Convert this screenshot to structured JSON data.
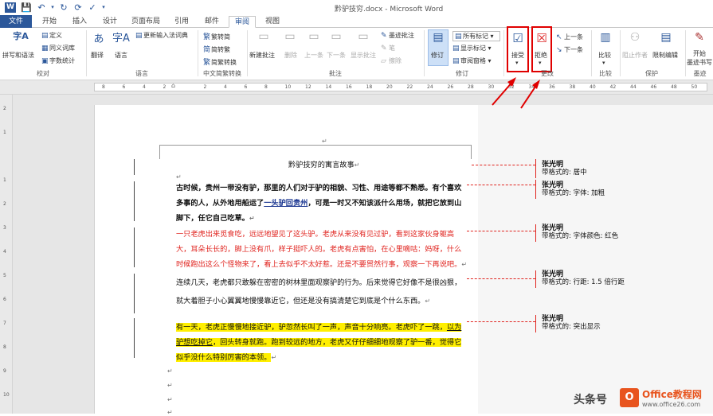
{
  "window": {
    "title": "黔驴技穷.docx - Microsoft Word",
    "quick_access": [
      "W",
      "💾",
      "↶",
      "↻",
      "⟳",
      "✓",
      "▾"
    ]
  },
  "tabs": [
    {
      "label": "文件"
    },
    {
      "label": "开始"
    },
    {
      "label": "插入"
    },
    {
      "label": "设计"
    },
    {
      "label": "页面布局"
    },
    {
      "label": "引用"
    },
    {
      "label": "邮件"
    },
    {
      "label": "审阅"
    },
    {
      "label": "视图"
    }
  ],
  "ribbon": {
    "proofing": {
      "label": "校对",
      "spelling": "拼写和语法",
      "define": "定义",
      "thesaurus": "同义词库",
      "word_count": "字数统计"
    },
    "language": {
      "label": "语言",
      "translate": "翻译",
      "language": "语言",
      "update_ime": "更新输入法词典"
    },
    "chinese": {
      "label": "中文简繁转换",
      "to_simplified": "繁转简",
      "to_traditional": "简转繁",
      "convert": "简繁转换"
    },
    "comments": {
      "label": "批注",
      "new": "新建批注",
      "delete": "删除",
      "previous": "上一条",
      "next": "下一条",
      "show": "显示批注",
      "ink": "墨迹批注",
      "pen": "笔",
      "erase": "擦除"
    },
    "tracking": {
      "label": "修订",
      "track": "修订",
      "all_markup": "所有标记",
      "show_markup": "显示标记",
      "review_pane": "审阅窗格"
    },
    "changes": {
      "label": "更改",
      "accept": "接受",
      "reject": "拒绝",
      "previous": "上一条",
      "next": "下一条"
    },
    "compare": {
      "label": "比较",
      "compare": "比较"
    },
    "protect": {
      "label": "保护",
      "block": "阻止作者",
      "restrict": "限制编辑"
    },
    "onenote": {
      "label": "墨迹",
      "start": "开始",
      "hide": "墨迹书写"
    }
  },
  "ruler": {
    "h_ticks": [
      "8",
      "6",
      "4",
      "2",
      "",
      "2",
      "4",
      "6",
      "8",
      "10",
      "12",
      "14",
      "16",
      "18",
      "20",
      "22",
      "24",
      "26",
      "28",
      "30",
      "32",
      "34",
      "36",
      "38",
      "40",
      "42",
      "44",
      "46",
      "48",
      "50"
    ],
    "v_ticks": [
      "2",
      "1",
      "",
      "1",
      "2",
      "3",
      "4",
      "5",
      "6",
      "7",
      "8",
      "9",
      "10"
    ]
  },
  "document": {
    "title": "黔驴技穷的寓言故事",
    "para1_line1": "古时候，贵州一带没有驴，那里的人们对于驴的相貌、习性、用途等都不熟悉。有个喜欢",
    "para1_line2_a": "多事的人，从外地用船运了",
    "para1_line2_b": "一头驴回贵州",
    "para1_line2_c": "，可是一时又不知该派什么用场，就把它放到山",
    "para1_line3": "脚下，任它自己吃草。",
    "para2_line1": "一只老虎出来觅食吃，远远地望见了这头驴。老虎从来没有见过驴，看到这家伙身躯高",
    "para2_line2": "大，耳朵长长的，脚上没有爪，样子挺吓人的。老虎有点害怕，在心里嘀咕：妈呀，什么",
    "para2_line3": "时候跑出这么个怪物来了，看上去似乎不太好惹。还是不要贸然行事，观察一下再说吧。",
    "para3_line1": "连续几天，老虎都只敢躲在密密的树林里面观察驴的行为。后来觉得它好像不是很凶狠，",
    "para3_line2": "就大着胆子小心翼翼地慢慢靠近它，但还是没有搞清楚它到底是个什么东西。",
    "para4_line1_a": "有一天，老虎正慢慢地接近驴，驴忽然长叫了一声，声音十分响亮。老虎吓了一跳，",
    "para4_line1_b": "以为",
    "para4_line2_a": "驴想吃掉它",
    "para4_line2_b": "，回头转身就跑。跑到较远的地方，老虎又仔仔细细地观察了驴一番，觉得它",
    "para4_line3": "似乎没什么特别厉害的本领。",
    "para_mark": "↵"
  },
  "balloons": [
    {
      "author": "张光明",
      "verb": "带格式的:",
      "detail": "居中"
    },
    {
      "author": "张光明",
      "verb": "带格式的:",
      "detail": "字体: 加粗"
    },
    {
      "author": "张光明",
      "verb": "带格式的:",
      "detail": "字体颜色: 红色"
    },
    {
      "author": "张光明",
      "verb": "带格式的:",
      "detail": "行距: 1.5 倍行距"
    },
    {
      "author": "张光明",
      "verb": "带格式的:",
      "detail": "突出显示"
    }
  ],
  "watermark": {
    "left": "头条号",
    "brand": "Office教程网",
    "url": "www.office26.com"
  },
  "colors": {
    "accent": "#2b579a",
    "revision": "#e0241f",
    "highlight": "#ffef00",
    "callout": "#e00000"
  }
}
